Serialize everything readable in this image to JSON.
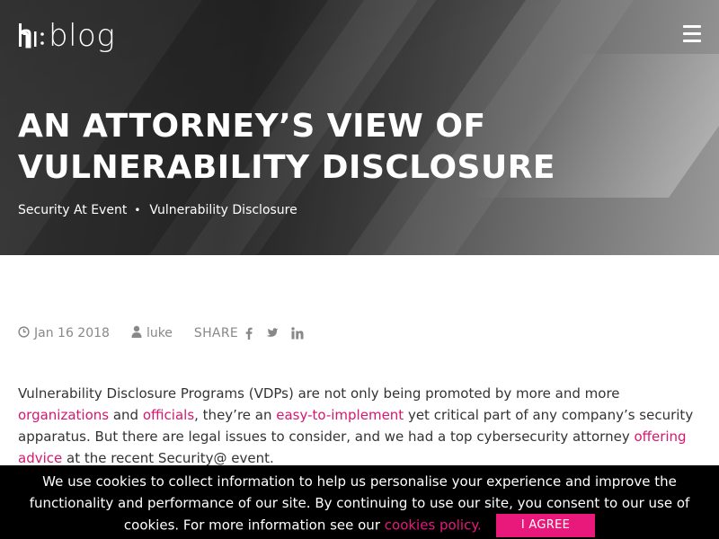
{
  "header": {
    "logo_text": "blog",
    "menu_icon": "hamburger-icon"
  },
  "hero": {
    "title": "AN ATTORNEY’S VIEW OF VULNERABILITY DISCLOSURE",
    "tags": [
      "Security At Event",
      "Vulnerability Disclosure"
    ],
    "tag_separator": "•"
  },
  "meta": {
    "date": "Jan 16 2018",
    "author": "luke",
    "share_label": "SHARE",
    "social_icons": [
      "facebook-icon",
      "twitter-icon",
      "linkedin-icon"
    ]
  },
  "article": {
    "p1_text1": "Vulnerability Disclosure Programs (VDPs) are not only being promoted by more and more ",
    "p1_link1": "organizations",
    "p1_text2": " and ",
    "p1_link2": "officials",
    "p1_text3": ", they’re an ",
    "p1_link3": "easy-to-implement",
    "p1_text4": " yet critical part of any company’s security apparatus. But there are legal issues to consider, and we had a top cybersecurity attorney ",
    "p1_link4": "offering advice",
    "p1_text5": " at the recent Security@ event."
  },
  "cookie": {
    "text": "We use cookies to collect information to help us personalise your experience and improve the functionality and performance of our site. By continuing to use our site, you consent to our use of cookies. For more information see our ",
    "link": "cookies policy.",
    "button": "I AGREE"
  },
  "colors": {
    "accent": "#e8197a",
    "link": "#d6166f",
    "cookie_bg": "#000000"
  }
}
